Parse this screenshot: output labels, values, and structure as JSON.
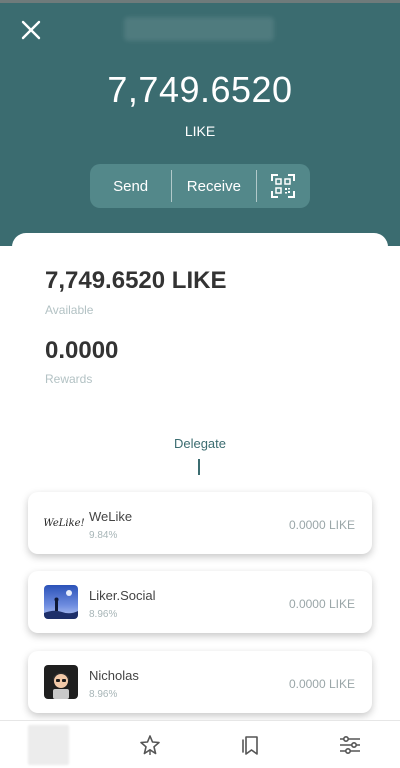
{
  "header": {
    "balance": "7,749.6520",
    "unit": "LIKE",
    "actions": {
      "send": "Send",
      "receive": "Receive"
    }
  },
  "summary": {
    "available_amount": "7,749.6520 LIKE",
    "available_label": "Available",
    "rewards_amount": "0.0000",
    "rewards_label": "Rewards"
  },
  "delegate": {
    "title": "Delegate",
    "validators": [
      {
        "name": "WeLike",
        "percent": "9.84%",
        "amount": "0.0000 LIKE",
        "logo_text": "WeLike!"
      },
      {
        "name": "Liker.Social",
        "percent": "8.96%",
        "amount": "0.0000 LIKE"
      },
      {
        "name": "Nicholas",
        "percent": "8.96%",
        "amount": "0.0000 LIKE"
      }
    ]
  },
  "icons": {
    "close": "close-icon",
    "qr": "qr-scan-icon",
    "star": "star-icon",
    "bookmark": "bookmarks-icon",
    "settings": "sliders-icon"
  },
  "colors": {
    "header_bg": "#3b6c70",
    "action_bg": "#53888a",
    "accent": "#3b6c70"
  }
}
